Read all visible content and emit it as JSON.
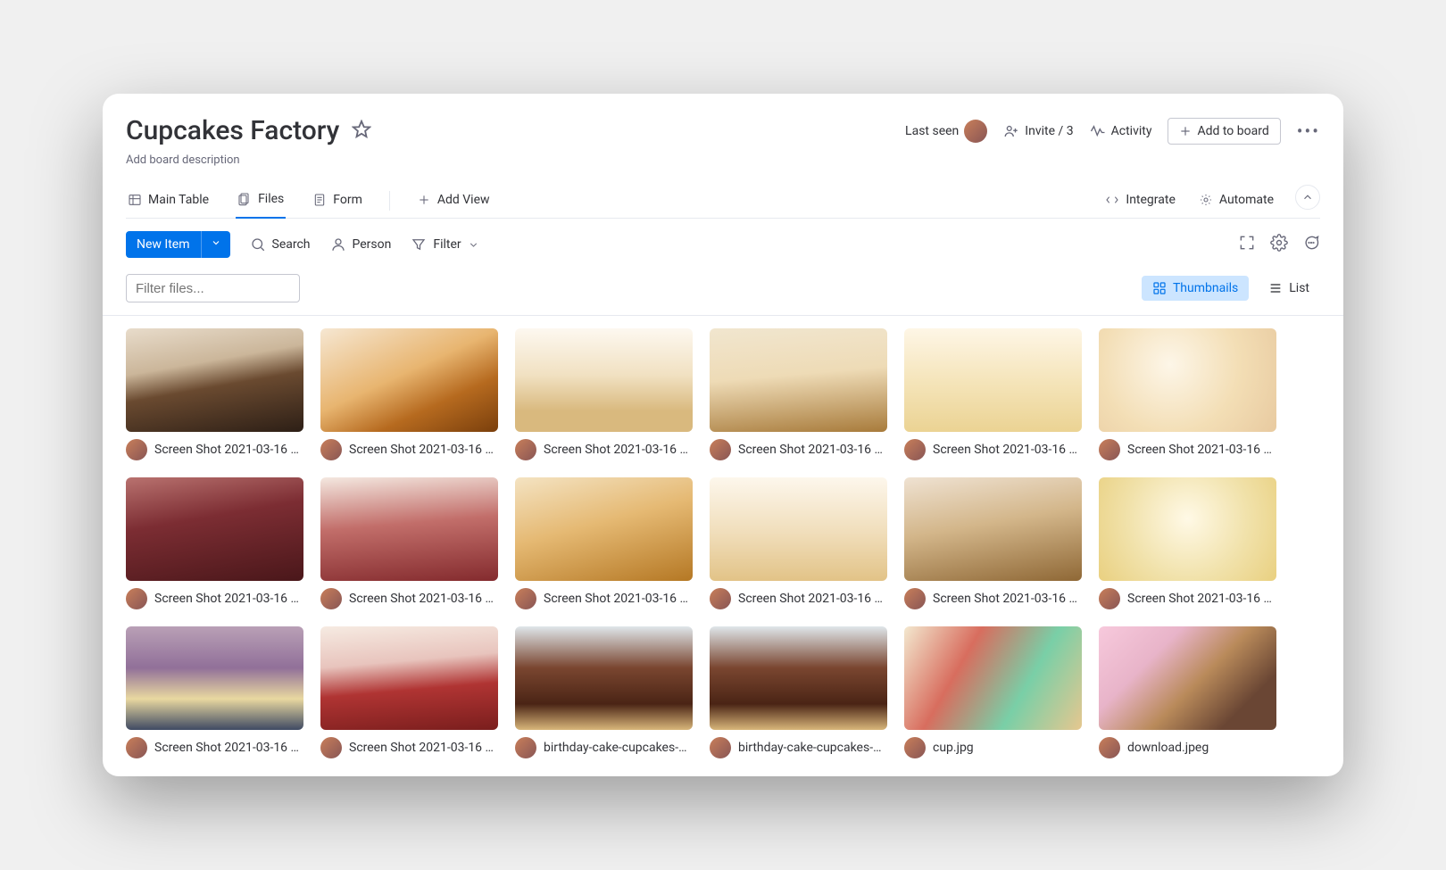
{
  "header": {
    "title": "Cupcakes Factory",
    "desc": "Add board description",
    "last_seen": "Last seen",
    "invite": "Invite / 3",
    "activity": "Activity",
    "add_to_board": "Add to board"
  },
  "tabs": {
    "main": "Main Table",
    "files": "Files",
    "form": "Form",
    "add_view": "Add View",
    "integrate": "Integrate",
    "automate": "Automate"
  },
  "toolbar": {
    "new_item": "New Item",
    "search": "Search",
    "person": "Person",
    "filter": "Filter"
  },
  "filter": {
    "placeholder": "Filter files...",
    "thumbnails": "Thumbnails",
    "list": "List"
  },
  "files": [
    {
      "name": "Screen Shot 2021-03-16 a...",
      "g": "g0"
    },
    {
      "name": "Screen Shot 2021-03-16 a...",
      "g": "g1"
    },
    {
      "name": "Screen Shot 2021-03-16 a...",
      "g": "g2"
    },
    {
      "name": "Screen Shot 2021-03-16 a...",
      "g": "g3"
    },
    {
      "name": "Screen Shot 2021-03-16 a...",
      "g": "g4"
    },
    {
      "name": "Screen Shot 2021-03-16 a...",
      "g": "g5"
    },
    {
      "name": "Screen Shot 2021-03-16 a...",
      "g": "g6"
    },
    {
      "name": "Screen Shot 2021-03-16 a...",
      "g": "g7"
    },
    {
      "name": "Screen Shot 2021-03-16 a...",
      "g": "g8"
    },
    {
      "name": "Screen Shot 2021-03-16 a...",
      "g": "g9"
    },
    {
      "name": "Screen Shot 2021-03-16 a...",
      "g": "g10"
    },
    {
      "name": "Screen Shot 2021-03-16 a...",
      "g": "g11"
    },
    {
      "name": "Screen Shot 2021-03-16 a...",
      "g": "g12"
    },
    {
      "name": "Screen Shot 2021-03-16 a...",
      "g": "g13"
    },
    {
      "name": "birthday-cake-cupcakes-w...",
      "g": "g14"
    },
    {
      "name": "birthday-cake-cupcakes-w...",
      "g": "g15"
    },
    {
      "name": "cup.jpg",
      "g": "g16"
    },
    {
      "name": "download.jpeg",
      "g": "g17"
    }
  ]
}
